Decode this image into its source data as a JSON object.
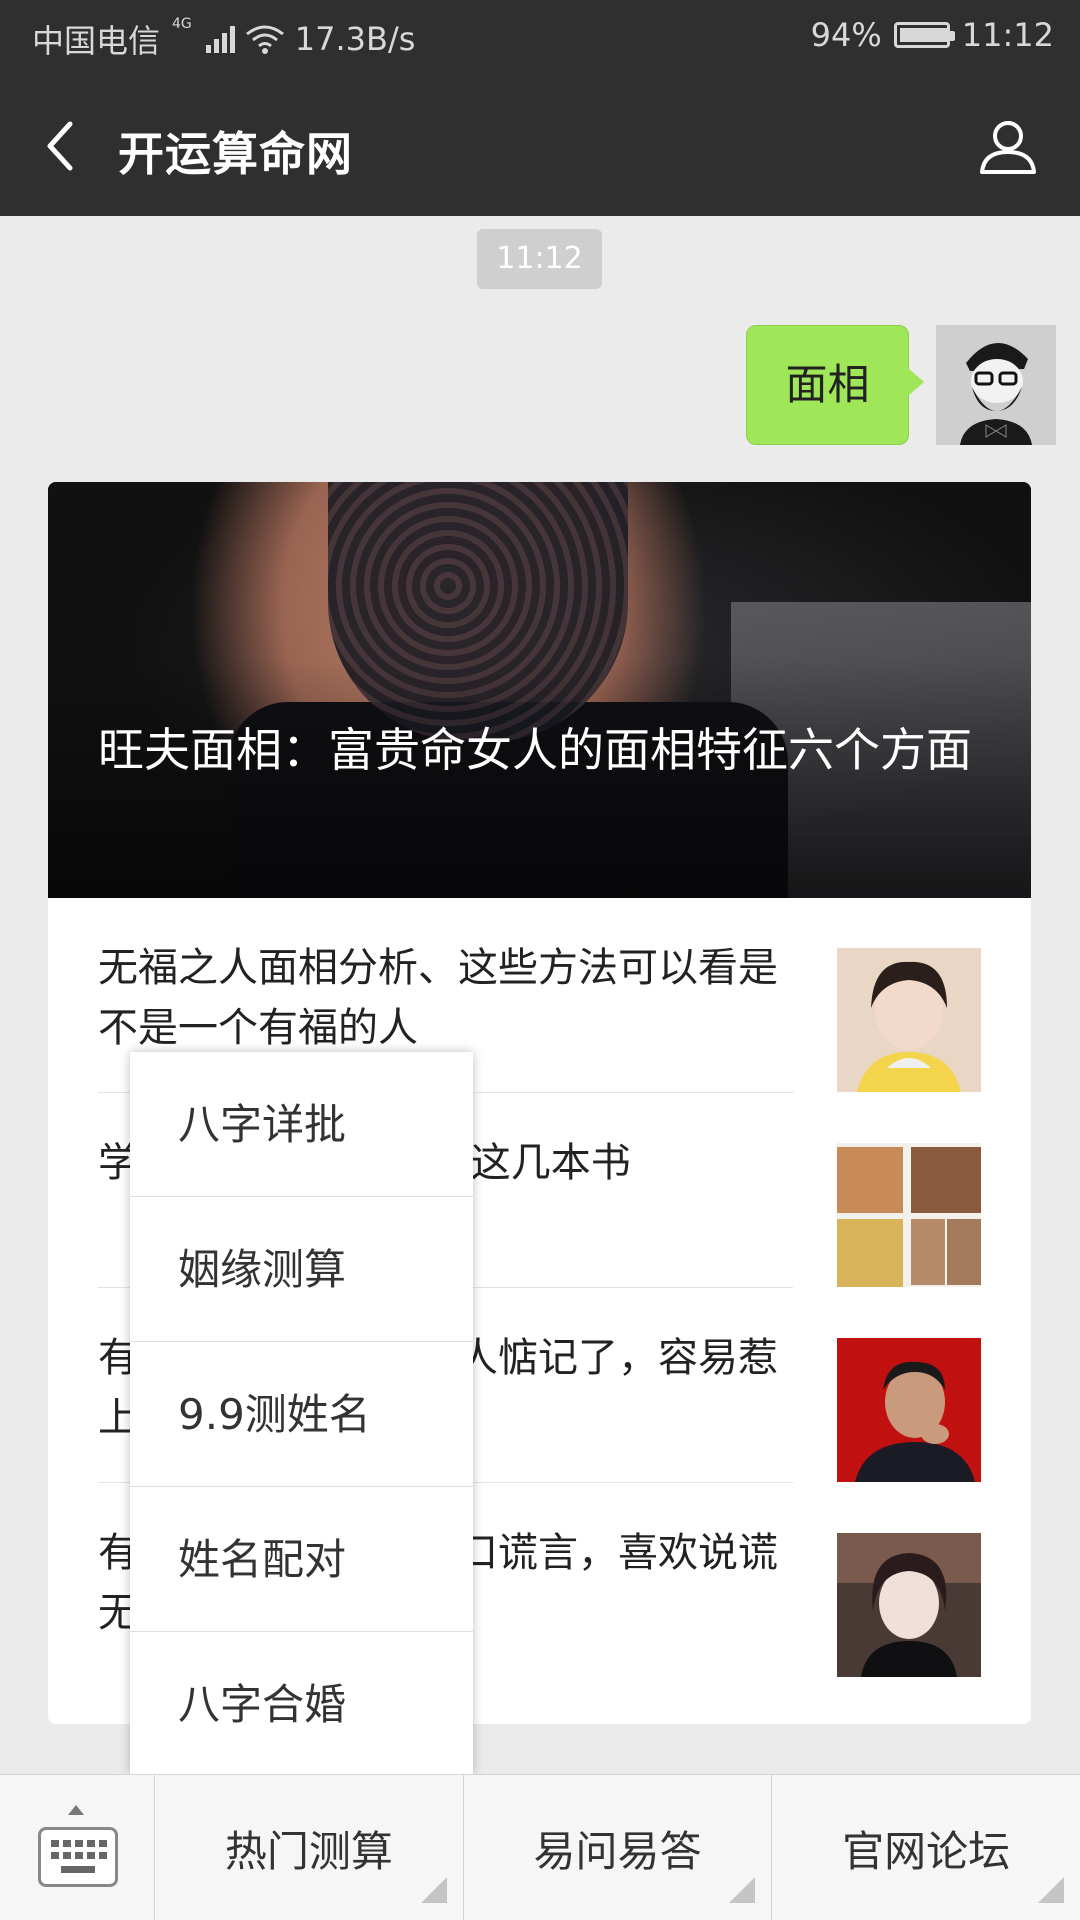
{
  "status_bar": {
    "carrier": "中国电信",
    "network": "4G",
    "speed": "17.3B/s",
    "battery_text": "94%",
    "battery_level": 0.94,
    "time": "11:12"
  },
  "header": {
    "title": "开运算命网",
    "back_icon": "back-arrow-icon",
    "profile_icon": "person-icon"
  },
  "chat": {
    "timestamp": "11:12",
    "sent_message": "面相"
  },
  "article_card": {
    "hero_title": "旺夫面相：富贵命女人的面相特征六个方面",
    "items": [
      {
        "title": "无福之人面相分析、这些方法可以看是不是一个有福的人"
      },
      {
        "title": "学面相需要看什么书,这几本书"
      },
      {
        "title": "有这种面相的人太招人惦记了，容易惹上是非"
      },
      {
        "title": "有这种面相的女人满口谎言，喜欢说谎无情寡义"
      }
    ]
  },
  "popup_menu": {
    "items": [
      "八字详批",
      "姻缘测算",
      "9.9测姓名",
      "姓名配对",
      "八字合婚"
    ]
  },
  "bottom_menu": {
    "keyboard_icon": "keyboard-icon",
    "items": [
      "热门测算",
      "易问易答",
      "官网论坛"
    ]
  }
}
